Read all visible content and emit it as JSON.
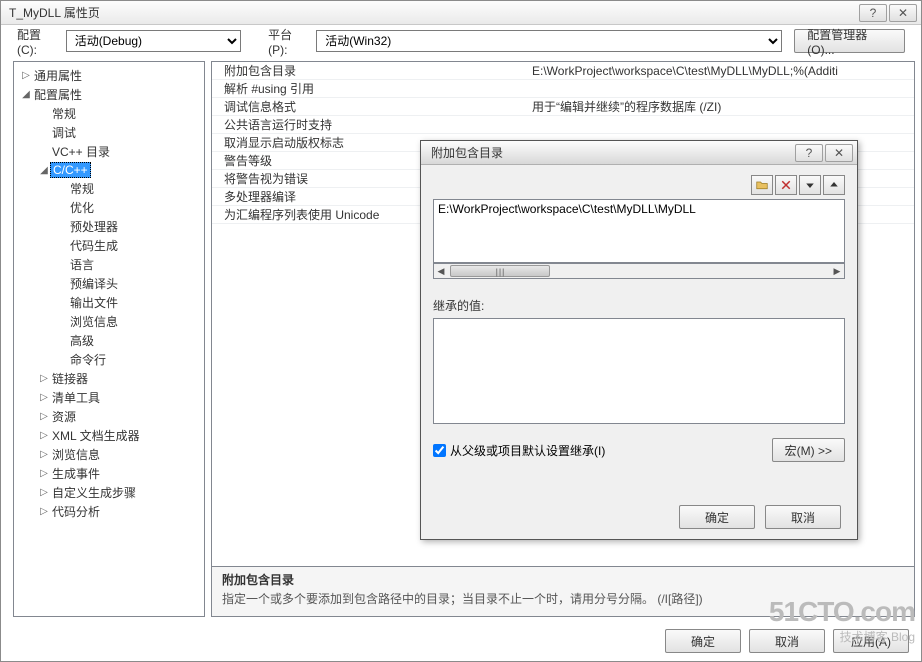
{
  "window": {
    "title": "T_MyDLL 属性页",
    "help_icon": "?",
    "close_icon": "✕"
  },
  "toolbar": {
    "config_label": "配置(C):",
    "config_value": "活动(Debug)",
    "platform_label": "平台(P):",
    "platform_value": "活动(Win32)",
    "config_mgr_button": "配置管理器(O)..."
  },
  "tree": [
    {
      "l": 0,
      "tw": "▷",
      "label": "通用属性"
    },
    {
      "l": 0,
      "tw": "◢",
      "label": "配置属性"
    },
    {
      "l": 1,
      "tw": "",
      "label": "常规"
    },
    {
      "l": 1,
      "tw": "",
      "label": "调试"
    },
    {
      "l": 1,
      "tw": "",
      "label": "VC++ 目录"
    },
    {
      "l": 1,
      "tw": "◢",
      "label": "C/C++",
      "selected": true
    },
    {
      "l": 2,
      "tw": "",
      "label": "常规"
    },
    {
      "l": 2,
      "tw": "",
      "label": "优化"
    },
    {
      "l": 2,
      "tw": "",
      "label": "预处理器"
    },
    {
      "l": 2,
      "tw": "",
      "label": "代码生成"
    },
    {
      "l": 2,
      "tw": "",
      "label": "语言"
    },
    {
      "l": 2,
      "tw": "",
      "label": "预编译头"
    },
    {
      "l": 2,
      "tw": "",
      "label": "输出文件"
    },
    {
      "l": 2,
      "tw": "",
      "label": "浏览信息"
    },
    {
      "l": 2,
      "tw": "",
      "label": "高级"
    },
    {
      "l": 2,
      "tw": "",
      "label": "命令行"
    },
    {
      "l": 1,
      "tw": "▷",
      "label": "链接器"
    },
    {
      "l": 1,
      "tw": "▷",
      "label": "清单工具"
    },
    {
      "l": 1,
      "tw": "▷",
      "label": "资源"
    },
    {
      "l": 1,
      "tw": "▷",
      "label": "XML 文档生成器"
    },
    {
      "l": 1,
      "tw": "▷",
      "label": "浏览信息"
    },
    {
      "l": 1,
      "tw": "▷",
      "label": "生成事件"
    },
    {
      "l": 1,
      "tw": "▷",
      "label": "自定义生成步骤"
    },
    {
      "l": 1,
      "tw": "▷",
      "label": "代码分析"
    }
  ],
  "grid": [
    {
      "name": "附加包含目录",
      "value": "E:\\WorkProject\\workspace\\C\\test\\MyDLL\\MyDLL;%(Additi"
    },
    {
      "name": "解析 #using 引用",
      "value": ""
    },
    {
      "name": "调试信息格式",
      "value": "用于“编辑并继续”的程序数据库 (/ZI)"
    },
    {
      "name": "公共语言运行时支持",
      "value": ""
    },
    {
      "name": "取消显示启动版权标志",
      "value": ""
    },
    {
      "name": "警告等级",
      "value": ""
    },
    {
      "name": "将警告视为错误",
      "value": ""
    },
    {
      "name": "多处理器编译",
      "value": ""
    },
    {
      "name": "为汇编程序列表使用 Unicode",
      "value": ""
    }
  ],
  "description": {
    "title": "附加包含目录",
    "text": "指定一个或多个要添加到包含路径中的目录；当目录不止一个时，请用分号分隔。     (/I[路径])"
  },
  "bottom": {
    "ok": "确定",
    "cancel": "取消",
    "apply": "应用(A)"
  },
  "modal": {
    "title": "附加包含目录",
    "help_icon": "?",
    "close_icon": "✕",
    "dir_value": "E:\\WorkProject\\workspace\\C\\test\\MyDLL\\MyDLL",
    "dir_scroll_marker": "III",
    "inherited_label": "继承的值:",
    "inherit_checkbox_label": "从父级或项目默认设置继承(I)",
    "macro_button": "宏(M) >>",
    "ok": "确定",
    "cancel": "取消"
  },
  "watermark": {
    "line1": "51CTO.com",
    "line2": "技术博客   Blog"
  }
}
